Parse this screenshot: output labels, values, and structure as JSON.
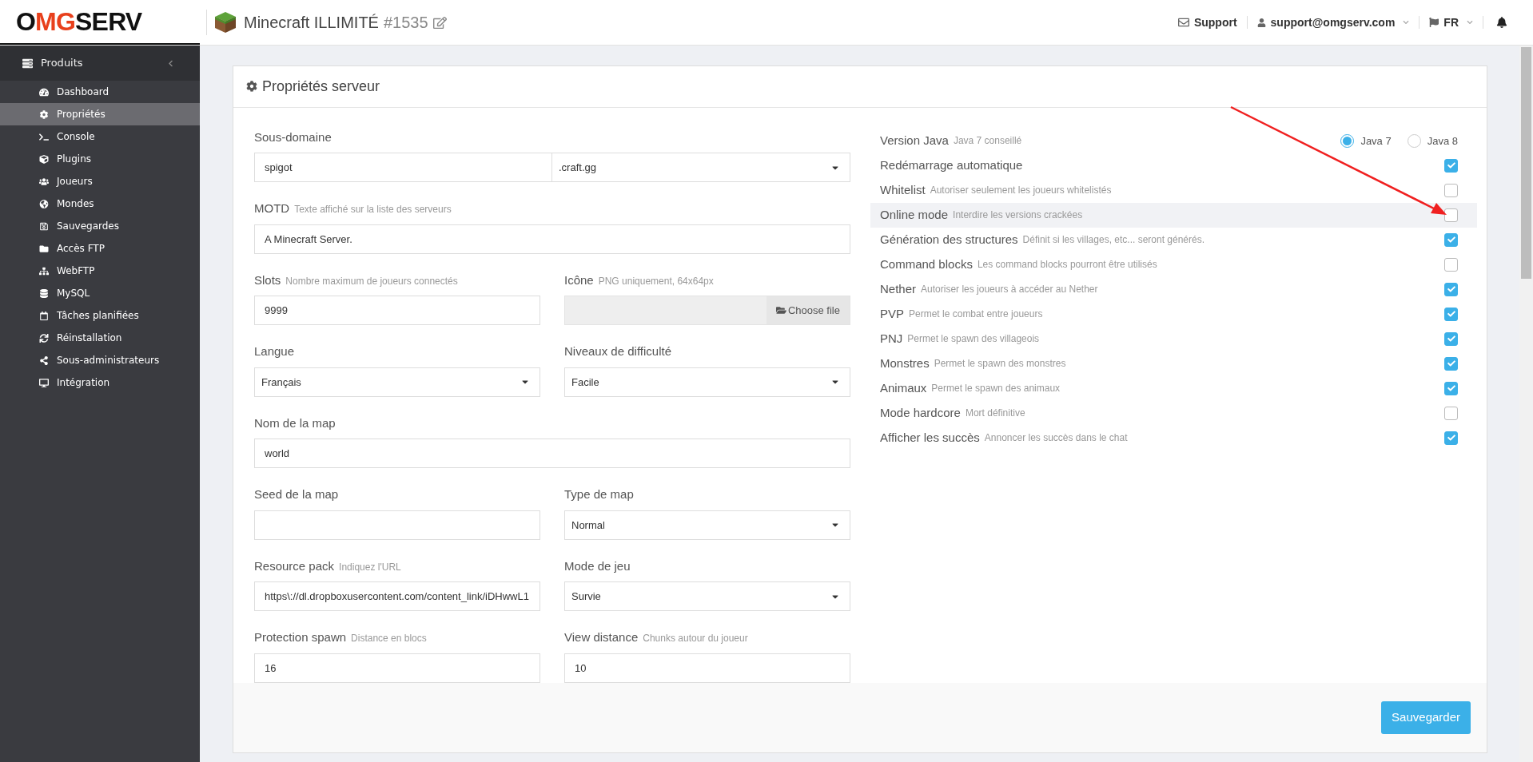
{
  "header": {
    "logo": {
      "prefix": "O",
      "accent": "MG",
      "suffix": "SERV"
    },
    "server_name": "Minecraft ILLIMITÉ",
    "server_id": "#1535",
    "support": "Support",
    "account": "support@omgserv.com",
    "language": "FR"
  },
  "sidebar": {
    "title": "Produits",
    "items": [
      {
        "label": "Dashboard",
        "selected": false
      },
      {
        "label": "Propriétés",
        "selected": true
      },
      {
        "label": "Console",
        "selected": false
      },
      {
        "label": "Plugins",
        "selected": false
      },
      {
        "label": "Joueurs",
        "selected": false
      },
      {
        "label": "Mondes",
        "selected": false
      },
      {
        "label": "Sauvegardes",
        "selected": false
      },
      {
        "label": "Accès FTP",
        "selected": false
      },
      {
        "label": "WebFTP",
        "selected": false
      },
      {
        "label": "MySQL",
        "selected": false
      },
      {
        "label": "Tâches planifiées",
        "selected": false
      },
      {
        "label": "Réinstallation",
        "selected": false
      },
      {
        "label": "Sous-administrateurs",
        "selected": false
      },
      {
        "label": "Intégration",
        "selected": false
      }
    ]
  },
  "panel": {
    "title": "Propriétés serveur",
    "fields": [
      {
        "kind": "combo",
        "label": "Sous-domaine",
        "value": "spigot",
        "select": ".craft.gg",
        "wide": true
      },
      {
        "kind": "text",
        "label": "MOTD",
        "hint": "Texte affiché sur la liste des serveurs",
        "value": "A Minecraft Server.",
        "wide": true
      },
      {
        "kind": "text",
        "label": "Slots",
        "hint": "Nombre maximum de joueurs connectés",
        "value": "9999",
        "wide": false
      },
      {
        "kind": "file",
        "label": "Icône",
        "hint": "PNG uniquement, 64x64px",
        "button": "Choose file",
        "wide": false
      },
      {
        "kind": "select",
        "label": "Langue",
        "value": "Français",
        "wide": false
      },
      {
        "kind": "select",
        "label": "Niveaux de difficulté",
        "value": "Facile",
        "wide": false
      },
      {
        "kind": "text",
        "label": "Nom de la map",
        "value": "world",
        "wide": true
      },
      {
        "kind": "text",
        "label": "Seed de la map",
        "wide": false
      },
      {
        "kind": "select",
        "label": "Type de map",
        "value": "Normal",
        "wide": false
      },
      {
        "kind": "text",
        "label": "Resource pack",
        "hint": "Indiquez l'URL",
        "value": "https\\://dl.dropboxusercontent.com/content_link/iDHwwL1",
        "wide": false
      },
      {
        "kind": "select",
        "label": "Mode de jeu",
        "value": "Survie",
        "wide": false
      },
      {
        "kind": "text",
        "label": "Protection spawn",
        "hint": "Distance en blocs",
        "value": "16",
        "wide": false
      },
      {
        "kind": "text",
        "label": "View distance",
        "hint": "Chunks autour du joueur",
        "value": "10",
        "wide": false
      }
    ],
    "java": {
      "label": "Version Java",
      "hint": "Java 7 conseillé",
      "options": [
        {
          "label": "Java 7",
          "selected": true
        },
        {
          "label": "Java 8",
          "selected": false
        }
      ]
    },
    "options": [
      {
        "label": "Redémarrage automatique",
        "checked": true,
        "hovered": false
      },
      {
        "label": "Whitelist",
        "hint": "Autoriser seulement les joueurs whitelistés",
        "checked": false,
        "hovered": false
      },
      {
        "label": "Online mode",
        "hint": "Interdire les versions crackées",
        "checked": false,
        "hovered": true
      },
      {
        "label": "Génération des structures",
        "hint": "Définit si les villages, etc... seront générés.",
        "checked": true,
        "hovered": false
      },
      {
        "label": "Command blocks",
        "hint": "Les command blocks pourront être utilisés",
        "checked": false,
        "hovered": false
      },
      {
        "label": "Nether",
        "hint": "Autoriser les joueurs à accéder au Nether",
        "checked": true,
        "hovered": false
      },
      {
        "label": "PVP",
        "hint": "Permet le combat entre joueurs",
        "checked": true,
        "hovered": false
      },
      {
        "label": "PNJ",
        "hint": "Permet le spawn des villageois",
        "checked": true,
        "hovered": false
      },
      {
        "label": "Monstres",
        "hint": "Permet le spawn des monstres",
        "checked": true,
        "hovered": false
      },
      {
        "label": "Animaux",
        "hint": "Permet le spawn des animaux",
        "checked": true,
        "hovered": false
      },
      {
        "label": "Mode hardcore",
        "hint": "Mort définitive",
        "checked": false,
        "hovered": false
      },
      {
        "label": "Afficher les succès",
        "hint": "Annoncer les succès dans le chat",
        "checked": true,
        "hovered": false
      }
    ],
    "save_button": "Sauvegarder"
  }
}
